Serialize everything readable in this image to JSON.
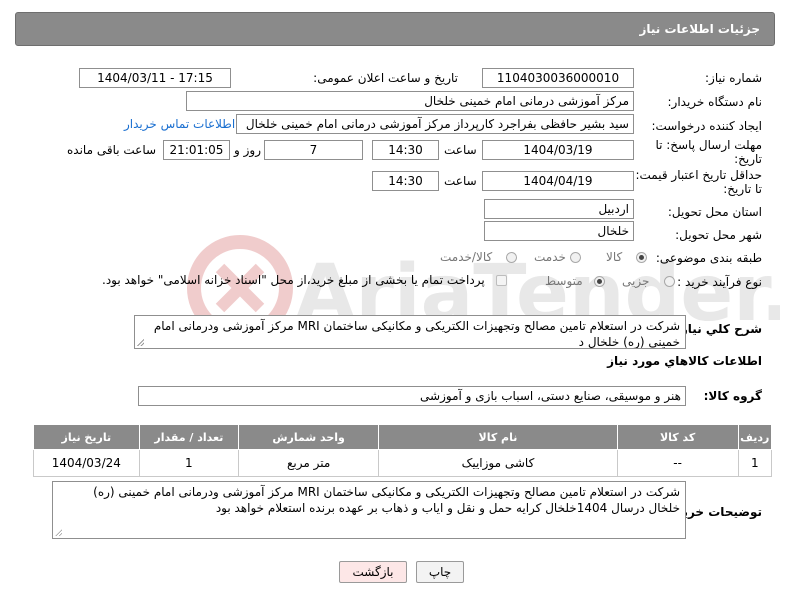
{
  "panel": {
    "title": "جزئیات اطلاعات نیاز"
  },
  "fields": {
    "need_number_label": "شماره نیاز:",
    "need_number": "1104030036000010",
    "announce_label": "تاریخ و ساعت اعلان عمومی:",
    "announce_value": "1404/03/11 - 17:15",
    "buyer_label": "نام دستگاه خریدار:",
    "buyer_value": "مرکز آموزشی درمانی امام خمینی خلخال",
    "creator_label": "ایجاد کننده درخواست:",
    "creator_value": "سید بشیر حافظی بفراجرد کارپرداز مرکز آموزشی درمانی امام خمینی خلخال",
    "contact_link": "اطلاعات تماس خریدار",
    "deadline_label_1": "مهلت ارسال پاسخ: تا",
    "deadline_label_2": "تاریخ:",
    "deadline_date": "1404/03/19",
    "time_label": "ساعت",
    "deadline_time": "14:30",
    "days_value": "7",
    "days_label": "روز و",
    "remaining_value": "21:01:05",
    "remaining_label": "ساعت باقی مانده",
    "validity_label_1": "حداقل تاریخ اعتبار قیمت:",
    "validity_label_2": "تا تاریخ:",
    "validity_date": "1404/04/19",
    "validity_time": "14:30",
    "province_label": "استان محل تحویل:",
    "province_value": "اردبیل",
    "city_label": "شهر محل تحویل:",
    "city_value": "خلخال",
    "category_label": "طبقه بندی موضوعی:",
    "category_options": [
      "کالا",
      "خدمت",
      "کالا/خدمت"
    ],
    "process_label": "نوع فرآیند خرید :",
    "process_options": [
      "جزیی",
      "متوسط"
    ],
    "payment_note": "پرداخت تمام یا بخشی از مبلغ خرید،از محل \"اسناد خزانه اسلامی\" خواهد بود."
  },
  "description": {
    "label": "شرح کلي نياز:",
    "text": "شرکت در استعلام تامین مصالح وتجهیزات الکتریکی و مکانیکی ساختمان MRI مرکز آموزشی ودرمانی امام خمینی (ره) خلخال د"
  },
  "goods": {
    "section_title": "اطلاعات کالاهاي مورد نياز",
    "group_label": "گروه کالا:",
    "group_value": "هنر و موسیقی، صنایع دستی، اسباب بازی و آموزشی"
  },
  "table": {
    "headers": [
      "ردیف",
      "کد کالا",
      "نام کالا",
      "واحد شمارش",
      "تعداد / مقدار",
      "تاریخ نیاز"
    ],
    "rows": [
      [
        "1",
        "--",
        "کاشی موزاییک",
        "متر مربع",
        "1",
        "1404/03/24"
      ]
    ]
  },
  "buyer_notes": {
    "label": "توضیحات خریدار:",
    "text": "شرکت در استعلام تامین مصالح وتجهیزات الکتریکی و مکانیکی ساختمان MRI مرکز آموزشی ودرمانی امام خمینی (ره) خلخال درسال 1404خلخال کرایه حمل و نقل و ایاب و ذهاب بر عهده برنده استعلام خواهد بود"
  },
  "buttons": {
    "print": "چاپ",
    "back": "بازگشت"
  },
  "watermark": {
    "text": "AriaTender.neT"
  },
  "colors": {
    "header": "#8a8a8a",
    "link": "#1a6fd0",
    "watermark": "#d8d8d8",
    "back_button": "#fde7e7"
  }
}
